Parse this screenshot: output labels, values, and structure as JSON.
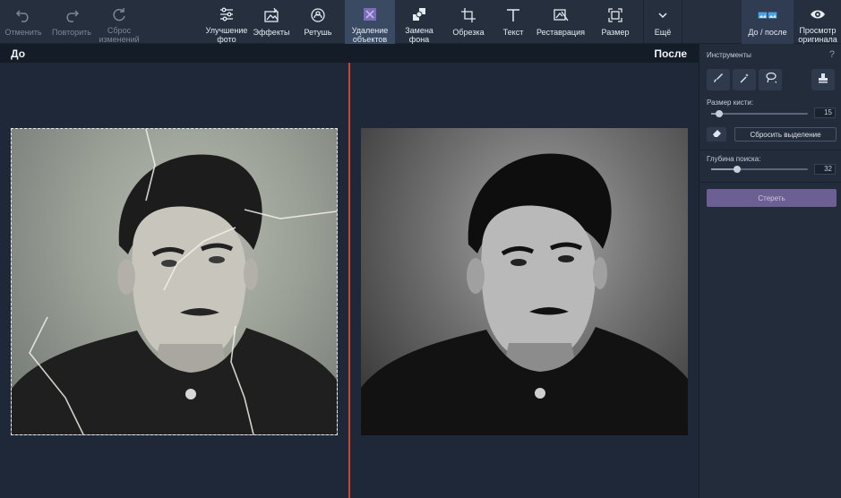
{
  "toolbar": {
    "undo": "Отменить",
    "redo": "Повторить",
    "reset": "Сброс\nизменений",
    "enhance": "Улучшение\nфото",
    "effects": "Эффекты",
    "retouch": "Ретушь",
    "remove_objects": "Удаление\nобъектов",
    "replace_bg": "Замена\nфона",
    "crop": "Обрезка",
    "text": "Текст",
    "restore": "Реставрация",
    "size": "Размер",
    "more": "Ещё",
    "before_after": "До / после",
    "view_original": "Просмотр\nоригинала"
  },
  "canvas": {
    "before_label": "До",
    "after_label": "После"
  },
  "panel": {
    "title": "Инструменты",
    "help": "?",
    "brush_size_label": "Размер кисти:",
    "brush_size_value": "15",
    "brush_size_fraction": 0.08,
    "reset_selection": "Сбросить выделение",
    "search_depth_label": "Глубина поиска:",
    "search_depth_value": "32",
    "search_depth_fraction": 0.27,
    "erase": "Стереть"
  },
  "colors": {
    "active_tab": "#3a4a63",
    "divider": "#c8472f",
    "erase_button": "#6b5f93"
  },
  "icons": {
    "undo": "undo-icon",
    "redo": "redo-icon",
    "reset": "reset-icon",
    "enhance": "sliders-icon",
    "effects": "effects-icon",
    "retouch": "retouch-icon",
    "remove_objects": "remove-objects-icon",
    "replace_bg": "replace-background-icon",
    "crop": "crop-icon",
    "text": "text-icon",
    "restore": "restore-icon",
    "size": "resize-icon",
    "more": "chevron-down-icon",
    "before_after": "before-after-icon",
    "view_original": "eye-icon"
  }
}
